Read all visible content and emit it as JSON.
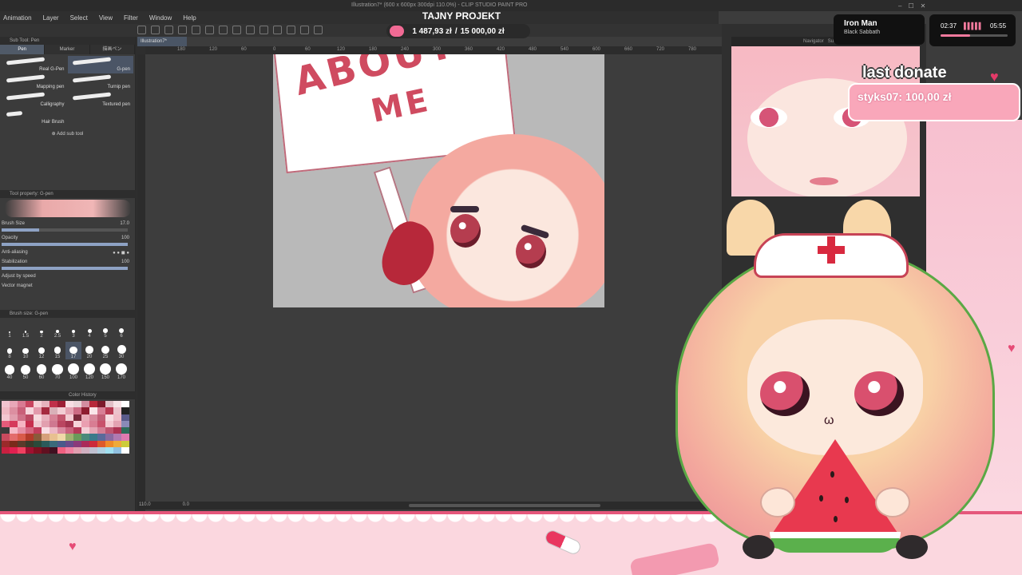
{
  "app": {
    "title": "Illustration7* (600 x 600px 300dpi 110.0%) - CLIP STUDIO PAINT PRO",
    "menu": [
      "Animation",
      "Layer",
      "Select",
      "View",
      "Filter",
      "Window",
      "Help"
    ],
    "window_controls": [
      "–",
      "☐",
      "✕"
    ],
    "document_tab": "Illustration7*"
  },
  "stream": {
    "title": "TAJNY PROJEKT",
    "goal": {
      "current": "1 487,93 zł",
      "target": "15 000,00 zł",
      "progress": 0.099
    },
    "now_playing": {
      "song": "Iron Man",
      "artist": "Black Sabbath"
    },
    "timer": {
      "elapsed": "02:37",
      "total": "05:55",
      "progress": 0.44
    },
    "last_donate": {
      "label": "last donate",
      "text": "styks07: 100,00 zł"
    }
  },
  "subtool": {
    "panel_title": "Sub Tool: Pen",
    "tabs": [
      "Pen",
      "Marker",
      "描画ペン"
    ],
    "active_tab": 0,
    "brushes": [
      {
        "label": "Real G-Pen",
        "selected": false
      },
      {
        "label": "G-pen",
        "selected": true
      },
      {
        "label": "Mapping pen",
        "selected": false
      },
      {
        "label": "Turnip pen",
        "selected": false
      },
      {
        "label": "Calligraphy",
        "selected": false
      },
      {
        "label": "Textured pen",
        "selected": false
      },
      {
        "label": "Hair Brush",
        "selected": false
      }
    ],
    "add_label": "Add sub tool"
  },
  "tool_property": {
    "title": "Tool property: G-pen",
    "rows": [
      {
        "label": "Brush Size",
        "value": "17.0"
      },
      {
        "label": "Opacity",
        "value": "100"
      },
      {
        "label": "Anti-aliasing",
        "value": ""
      },
      {
        "label": "Stabilization",
        "value": "100"
      },
      {
        "label": "Adjust by speed",
        "value": ""
      },
      {
        "label": "Vector magnet",
        "value": ""
      }
    ],
    "bars": [
      0.3,
      1.0,
      0,
      1.0
    ]
  },
  "brush_size": {
    "title": "Brush size: G-pen",
    "sizes": [
      "1",
      "1.5",
      "2",
      "2.5",
      "3",
      "4",
      "5",
      "6",
      "8",
      "10",
      "12",
      "15",
      "17",
      "20",
      "25",
      "30",
      "40",
      "50",
      "60",
      "70",
      "100",
      "120",
      "150",
      "170"
    ],
    "selected": "17"
  },
  "color_history": {
    "title": "Color History",
    "colors": [
      "#f2c4cf",
      "#e8a7b8",
      "#d97a92",
      "#c8455f",
      "#f5d0d6",
      "#e6b3bd",
      "#c0304a",
      "#9c1f35",
      "#f8dee3",
      "#ead5d8",
      "#d38da0",
      "#b7283a",
      "#7d1a2a",
      "#e2c0c7",
      "#f7e3e6",
      "#ffffff",
      "#f0b8c2",
      "#dc8fa1",
      "#c96079",
      "#f6d6dd",
      "#e39aac",
      "#a52a3f",
      "#d9b0b8",
      "#f2cdd4",
      "#e4a2b1",
      "#cc6b83",
      "#8e1d30",
      "#f9e6e9",
      "#d77f95",
      "#b93b53",
      "#ecc3cc",
      "#222222",
      "#f4c7d0",
      "#e19eae",
      "#cf7188",
      "#bb4a63",
      "#f7d9de",
      "#e8b0bd",
      "#d68296",
      "#c3566d",
      "#f3ccd3",
      "#7a2a3a",
      "#e8aab7",
      "#d7889b",
      "#c15f76",
      "#f6dce1",
      "#efbcc7",
      "#5a5a8a",
      "#e65b7a",
      "#d63a5c",
      "#f5b5c3",
      "#c72f4e",
      "#f0c9d1",
      "#e2a0af",
      "#cf7890",
      "#ba4560",
      "#a33550",
      "#f7d4db",
      "#ea9fb1",
      "#d87d93",
      "#c8526c",
      "#f4cad2",
      "#e3a3b2",
      "#8a8ab8",
      "#3a3a3a",
      "#f5b9c6",
      "#e68ea4",
      "#d56680",
      "#c23e5c",
      "#f8dde3",
      "#ecb7c3",
      "#da8aa0",
      "#c9617c",
      "#b43a58",
      "#f3ced6",
      "#e5a6b5",
      "#d37e95",
      "#bf5671",
      "#ad3452",
      "#2e6b5a",
      "#c84a5e",
      "#e36c6c",
      "#d95a4a",
      "#b33a2a",
      "#8a5a3a",
      "#d6a07a",
      "#e8c090",
      "#f0d8a8",
      "#a0b070",
      "#6a9a5a",
      "#4a8a7a",
      "#3a7a8a",
      "#5a6a9a",
      "#8a6aa0",
      "#b07ab0",
      "#e07ab0",
      "#9a2a2a",
      "#7a2a1a",
      "#5a3a2a",
      "#3a3a2a",
      "#2a4a3a",
      "#2a5a5a",
      "#3a6a7a",
      "#4a5a8a",
      "#6a4a8a",
      "#8a3a7a",
      "#aa2a5a",
      "#cc2a3a",
      "#dd5a2a",
      "#ee8a2a",
      "#eeaa3a",
      "#cccc3a",
      "#c82040",
      "#e02050",
      "#f04060",
      "#a01030",
      "#801020",
      "#601020",
      "#401020",
      "#f06080",
      "#f080a0",
      "#e0a0b0",
      "#d0b0c0",
      "#c0c0d0",
      "#b0d0e0",
      "#a0e0f0",
      "#90c0e0",
      "#ffffff"
    ]
  },
  "canvas": {
    "ruler_marks": [
      "180",
      "120",
      "60",
      "0",
      "60",
      "120",
      "180",
      "240",
      "300",
      "360",
      "420",
      "480",
      "540",
      "600",
      "660",
      "720",
      "780"
    ],
    "sign_line1": "ABOUT",
    "sign_line2": "ME",
    "zoom": "110.0",
    "rotation": "0.0"
  },
  "dock": {
    "tabs": [
      "Navigator",
      "Sub View"
    ]
  }
}
